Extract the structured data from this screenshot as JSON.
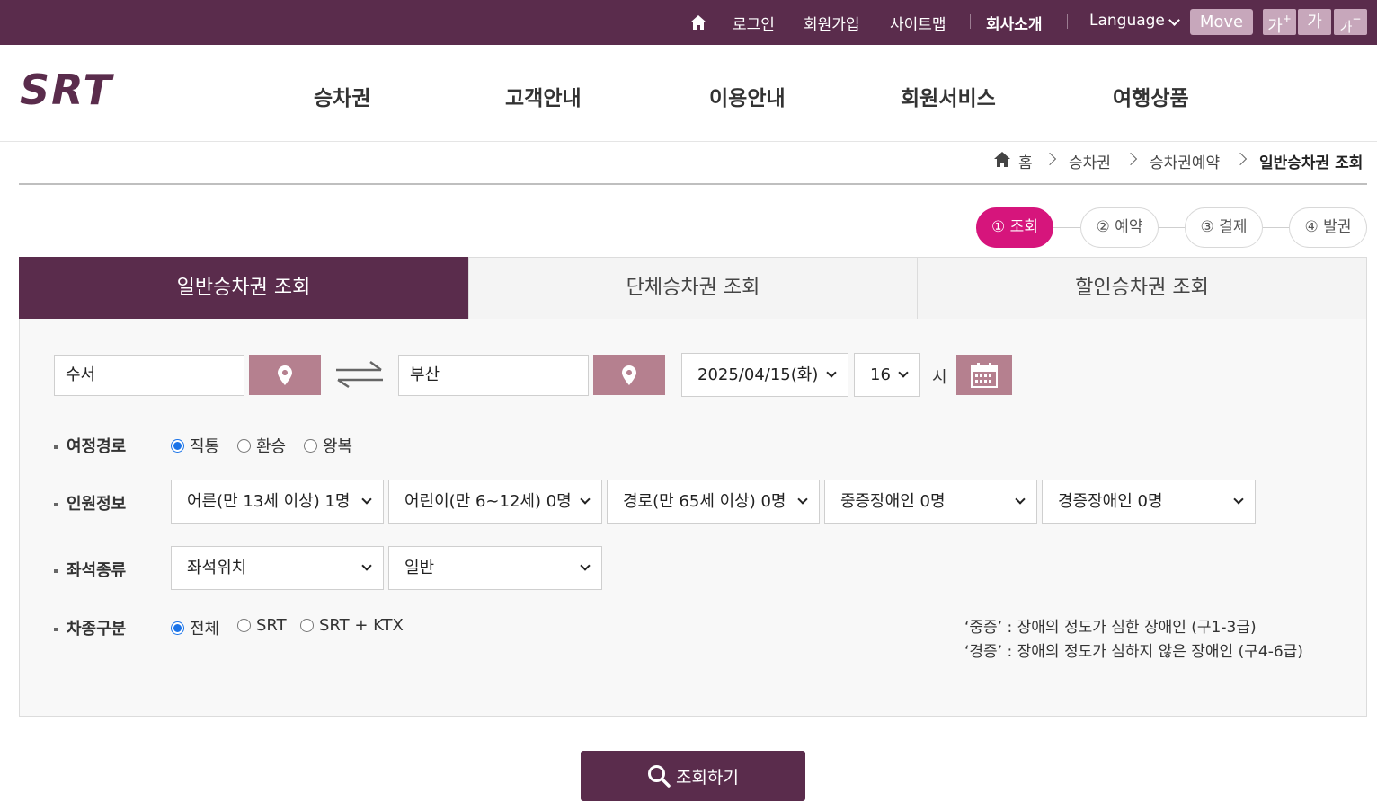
{
  "topbar": {
    "login": "로그인",
    "signup": "회원가입",
    "sitemap": "사이트맵",
    "company": "회사소개",
    "language": "Language",
    "move": "Move",
    "font_up": "가",
    "font_normal": "가",
    "font_down": "가",
    "font_up_sign": "+",
    "font_down_sign": "−"
  },
  "logo_text": "SRT",
  "nav": [
    "승차권",
    "고객안내",
    "이용안내",
    "회원서비스",
    "여행상품"
  ],
  "breadcrumb": [
    "홈",
    "승차권",
    "승차권예약",
    "일반승차권 조회"
  ],
  "steps": [
    "① 조회",
    "② 예약",
    "③ 결제",
    "④ 발권"
  ],
  "tabs": [
    "일반승차권 조회",
    "단체승차권 조회",
    "할인승차권 조회"
  ],
  "search": {
    "departure": "수서",
    "arrival": "부산",
    "date": "2025/04/15(화)",
    "hour": "16",
    "hour_unit": "시"
  },
  "route": {
    "label": "여정경로",
    "options": [
      "직통",
      "환승",
      "왕복"
    ],
    "selected": "직통"
  },
  "passengers": {
    "label": "인원정보",
    "selects": [
      "어른(만 13세 이상) 1명",
      "어린이(만 6~12세) 0명",
      "경로(만 65세 이상) 0명",
      "중증장애인 0명",
      "경증장애인 0명"
    ]
  },
  "seat": {
    "label": "좌석종류",
    "selects": [
      "좌석위치",
      "일반"
    ]
  },
  "train_type": {
    "label": "차종구분",
    "options": [
      "전체",
      "SRT",
      "SRT + KTX"
    ],
    "selected": "전체"
  },
  "notes": [
    "‘중증’ : 장애의 정도가 심한 장애인 (구1-3급)",
    "‘경증’ : 장애의 정도가 심하지 않은 장애인 (구4-6급)"
  ],
  "search_button": "조회하기",
  "colors": {
    "brand": "#5a2c4c",
    "accent_pink": "#d6157c",
    "button_mauve": "#b5808f"
  }
}
